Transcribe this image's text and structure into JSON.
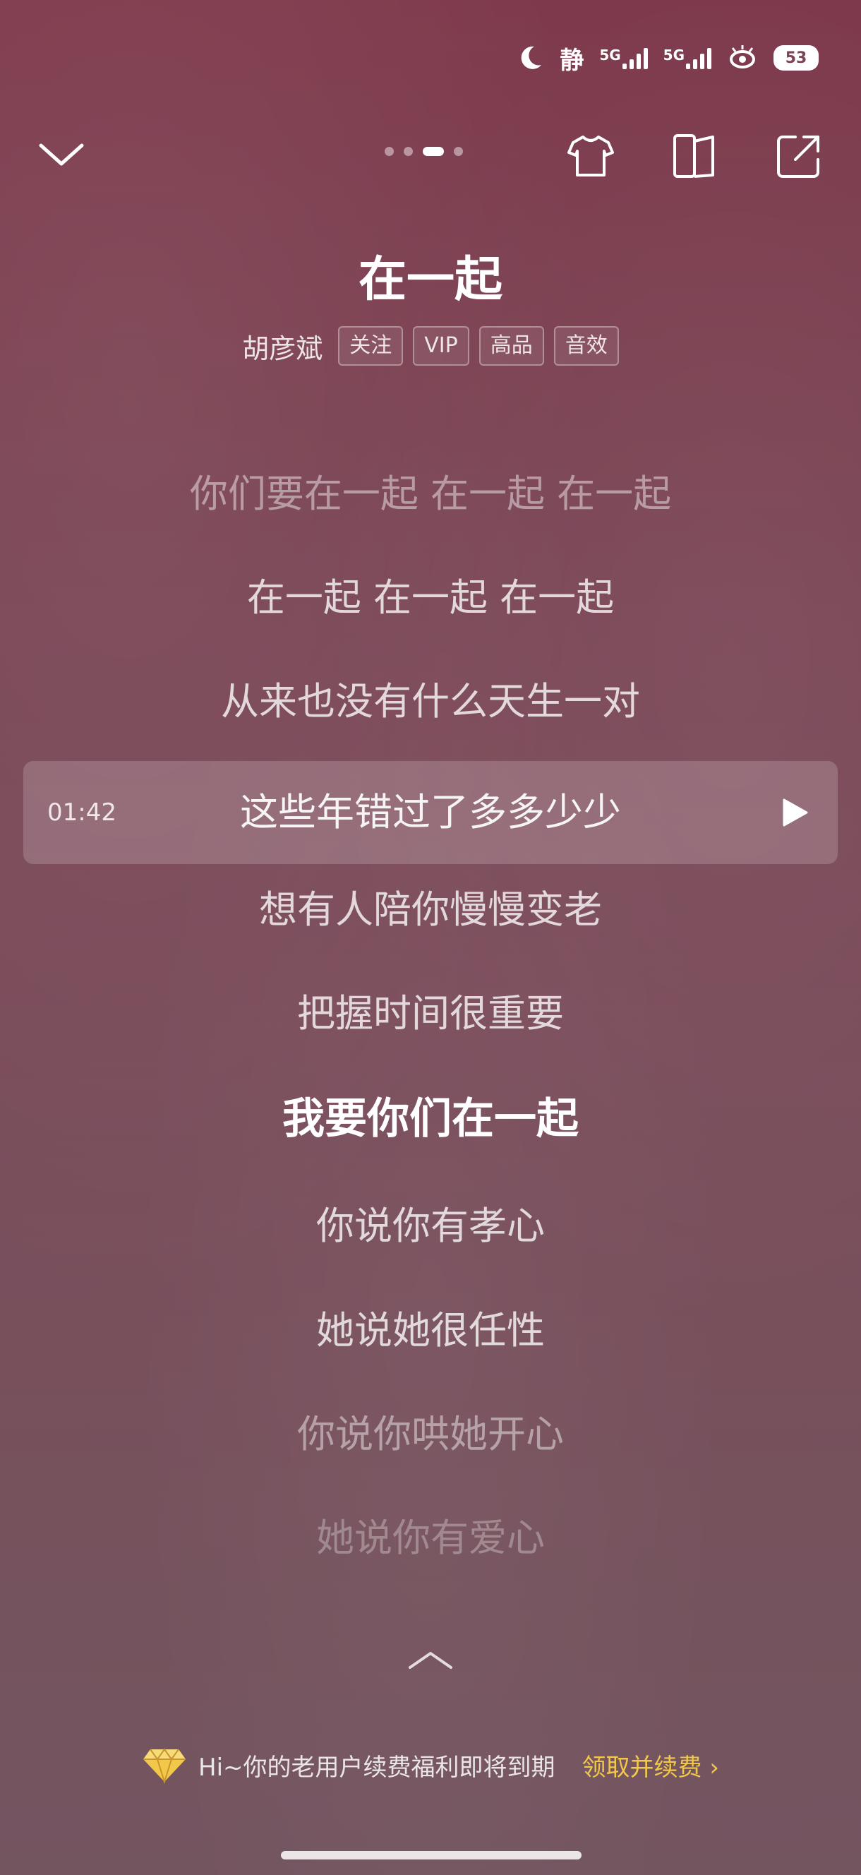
{
  "status_bar": {
    "moon_icon": "moon-icon",
    "quiet_label": "静",
    "signal_labels": [
      "5G",
      "5G"
    ],
    "battery": "53"
  },
  "top_bar": {
    "page_count": 4,
    "active_page": 3
  },
  "song": {
    "title": "在一起",
    "artist": "胡彦斌",
    "tags": [
      "关注",
      "VIP",
      "高品",
      "音效"
    ]
  },
  "lyrics": {
    "lines": [
      "你们要在一起 在一起 在一起",
      "在一起 在一起 在一起",
      "从来也没有什么天生一对",
      "这些年错过了多多少少",
      "想有人陪你慢慢变老",
      "把握时间很重要",
      "我要你们在一起",
      "你说你有孝心",
      "她说她很任性",
      "你说你哄她开心",
      "她说你有爱心"
    ],
    "selected_time": "01:42",
    "selected_index": 3,
    "current_index": 6
  },
  "promo": {
    "text": "Hi~你的老用户续费福利即将到期",
    "link": "领取并续费 ›",
    "link_color": "#f2c84b"
  }
}
